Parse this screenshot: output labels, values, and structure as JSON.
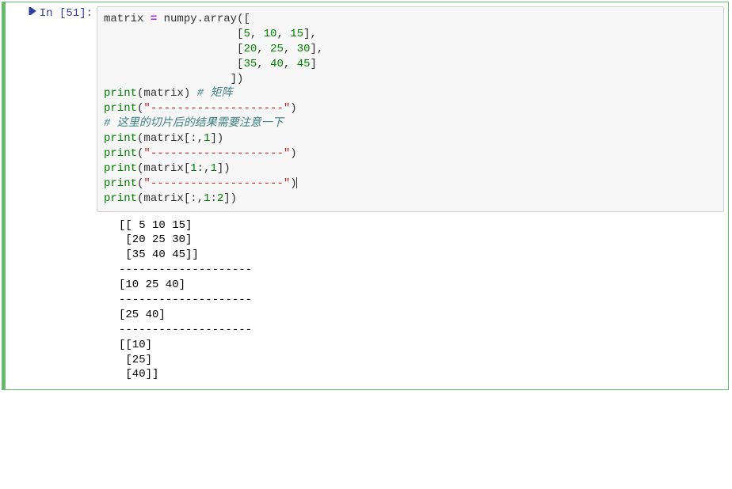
{
  "cell": {
    "prompt_label": "In",
    "prompt_number": "[51]:",
    "code_tokens": [
      [
        {
          "t": "matrix ",
          "c": "name"
        },
        {
          "t": "=",
          "c": "operator"
        },
        {
          "t": " numpy",
          "c": "name"
        },
        {
          "t": ".",
          "c": "punct"
        },
        {
          "t": "array",
          "c": "name"
        },
        {
          "t": "([",
          "c": "punct"
        }
      ],
      [
        {
          "t": "                    [",
          "c": "punct"
        },
        {
          "t": "5",
          "c": "number"
        },
        {
          "t": ", ",
          "c": "punct"
        },
        {
          "t": "10",
          "c": "number"
        },
        {
          "t": ", ",
          "c": "punct"
        },
        {
          "t": "15",
          "c": "number"
        },
        {
          "t": "],",
          "c": "punct"
        }
      ],
      [
        {
          "t": "                    [",
          "c": "punct"
        },
        {
          "t": "20",
          "c": "number"
        },
        {
          "t": ", ",
          "c": "punct"
        },
        {
          "t": "25",
          "c": "number"
        },
        {
          "t": ", ",
          "c": "punct"
        },
        {
          "t": "30",
          "c": "number"
        },
        {
          "t": "],",
          "c": "punct"
        }
      ],
      [
        {
          "t": "                    [",
          "c": "punct"
        },
        {
          "t": "35",
          "c": "number"
        },
        {
          "t": ", ",
          "c": "punct"
        },
        {
          "t": "40",
          "c": "number"
        },
        {
          "t": ", ",
          "c": "punct"
        },
        {
          "t": "45",
          "c": "number"
        },
        {
          "t": "]",
          "c": "punct"
        }
      ],
      [
        {
          "t": "                   ])",
          "c": "punct"
        }
      ],
      [
        {
          "t": "print",
          "c": "builtin"
        },
        {
          "t": "(matrix) ",
          "c": "punct"
        },
        {
          "t": "# 矩阵",
          "c": "comment"
        }
      ],
      [
        {
          "t": "print",
          "c": "builtin"
        },
        {
          "t": "(",
          "c": "punct"
        },
        {
          "t": "\"",
          "c": "string"
        },
        {
          "t": "--------------------",
          "c": "string-dash"
        },
        {
          "t": "\"",
          "c": "string"
        },
        {
          "t": ")",
          "c": "punct"
        }
      ],
      [
        {
          "t": "# 这里的切片后的结果需要注意一下",
          "c": "comment"
        }
      ],
      [
        {
          "t": "print",
          "c": "builtin"
        },
        {
          "t": "(matrix[:,",
          "c": "punct"
        },
        {
          "t": "1",
          "c": "number"
        },
        {
          "t": "])",
          "c": "punct"
        }
      ],
      [
        {
          "t": "print",
          "c": "builtin"
        },
        {
          "t": "(",
          "c": "punct"
        },
        {
          "t": "\"",
          "c": "string"
        },
        {
          "t": "--------------------",
          "c": "string-dash"
        },
        {
          "t": "\"",
          "c": "string"
        },
        {
          "t": ")",
          "c": "punct"
        }
      ],
      [
        {
          "t": "print",
          "c": "builtin"
        },
        {
          "t": "(matrix[",
          "c": "punct"
        },
        {
          "t": "1",
          "c": "number"
        },
        {
          "t": ":,",
          "c": "punct"
        },
        {
          "t": "1",
          "c": "number"
        },
        {
          "t": "])",
          "c": "punct"
        }
      ],
      [
        {
          "t": "print",
          "c": "builtin"
        },
        {
          "t": "(",
          "c": "punct"
        },
        {
          "t": "\"",
          "c": "string"
        },
        {
          "t": "--------------------",
          "c": "string-dash"
        },
        {
          "t": "\"",
          "c": "string"
        },
        {
          "t": ")",
          "c": "punct"
        },
        {
          "t": "|",
          "c": "cursor"
        }
      ],
      [
        {
          "t": "print",
          "c": "builtin"
        },
        {
          "t": "(matrix[:,",
          "c": "punct"
        },
        {
          "t": "1",
          "c": "number"
        },
        {
          "t": ":",
          "c": "punct"
        },
        {
          "t": "2",
          "c": "number"
        },
        {
          "t": "])",
          "c": "punct"
        }
      ]
    ],
    "output": "[[ 5 10 15]\n [20 25 30]\n [35 40 45]]\n--------------------\n[10 25 40]\n--------------------\n[25 40]\n--------------------\n[[10]\n [25]\n [40]]"
  }
}
